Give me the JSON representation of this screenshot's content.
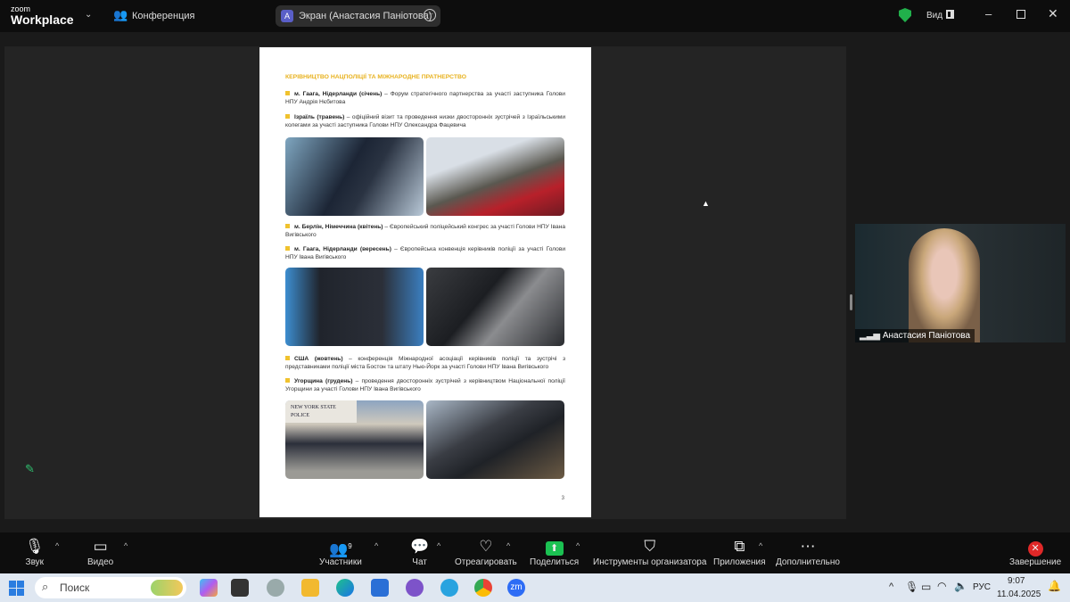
{
  "topbar": {
    "logo_small": "zoom",
    "logo_big": "Workplace",
    "meeting_label": "Конференция",
    "share_label": "Экран (Анастасия Паніотова)",
    "share_avatar": "A",
    "view_label": "Вид"
  },
  "document": {
    "heading": "КЕРІВНИЦТВО НАЦПОЛІЦІЇ ТА МІЖНАРОДНЕ ПРАТНЕРСТВО",
    "items": [
      {
        "bold": "м. Гаага, Нідерланди (січень)",
        "text": " – Форум стратегічного партнерства за участі заступника Голови НПУ Андрія Нєбитова"
      },
      {
        "bold": "Ізраїль (травень)",
        "text": " – офіційний візит та проведення низки двосторонніх зустрічей з Ізраїльськими колегами за участі заступника Голови НПУ Олександра Фацевича"
      },
      {
        "bold": "м. Берлін, Німеччина (квітень)",
        "text": " – Європейський поліцейський конгрес за участі Голови НПУ Івана Вигівського"
      },
      {
        "bold": "м. Гаага, Нідерланди (вересень)",
        "text": " – Європейська конвенція керівників поліції за участі Голови НПУ Івана Вигівського"
      },
      {
        "bold": "США (жовтень)",
        "text": " – конференція Міжнародної асоціації керівників поліції та зустрічі з представниками поліції міста Бостон та штату Нью-Йорк за участі Голови НПУ Івана Вигівського"
      },
      {
        "bold": "Угорщина (грудень)",
        "text": " – проведення двосторонніх зустрічей з керівництвом Національної поліції Угорщини за участі Голови НПУ Івана Вигівського"
      }
    ],
    "photo_sign": "NEW YORK STATE POLICE",
    "page_number": "3"
  },
  "video": {
    "name": "Анастасия Паніотова"
  },
  "toolbar": {
    "audio": "Звук",
    "video": "Видео",
    "participants": "Участники",
    "participants_count": "9",
    "chat": "Чат",
    "react": "Отреагировать",
    "share": "Поделиться",
    "host_tools": "Инструменты организатора",
    "apps": "Приложения",
    "more": "Дополнительно",
    "end": "Завершение"
  },
  "taskbar": {
    "search_placeholder": "Поиск",
    "lang": "РУС",
    "time": "9:07",
    "date": "11.04.2025"
  }
}
